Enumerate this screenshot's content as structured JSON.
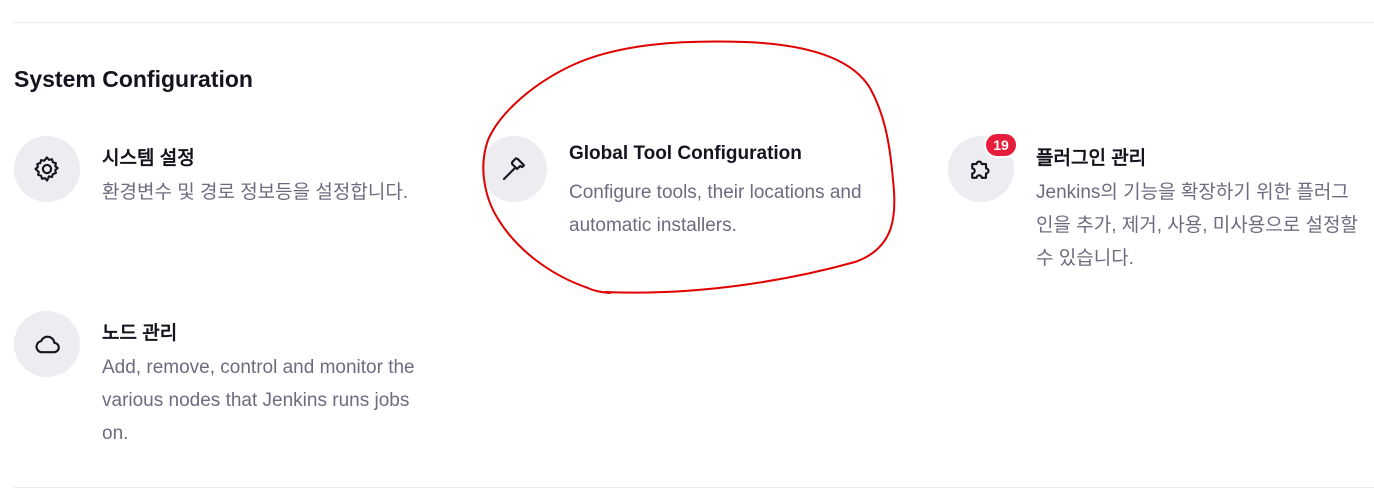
{
  "section": {
    "title": "System Configuration"
  },
  "items": [
    {
      "icon": "gear-icon",
      "title": "시스템 설정",
      "desc": "환경변수 및 경로 정보등을 설정합니다."
    },
    {
      "icon": "hammer-icon",
      "title": "Global Tool Configuration",
      "desc": "Configure tools, their locations and automatic installers."
    },
    {
      "icon": "puzzle-icon",
      "title": "플러그인 관리",
      "desc": "Jenkins의 기능을 확장하기 위한 플러그인을 추가, 제거, 사용, 미사용으로 설정할 수 있습니다.",
      "badge": "19"
    },
    {
      "icon": "cloud-icon",
      "title": "노드 관리",
      "desc": "Add, remove, control and monitor the various nodes that Jenkins runs jobs on."
    }
  ],
  "colors": {
    "badge": "#e61e3c",
    "annotation": "#e00000",
    "icon_bg": "#ececf1",
    "desc_text": "#6c6c80"
  }
}
